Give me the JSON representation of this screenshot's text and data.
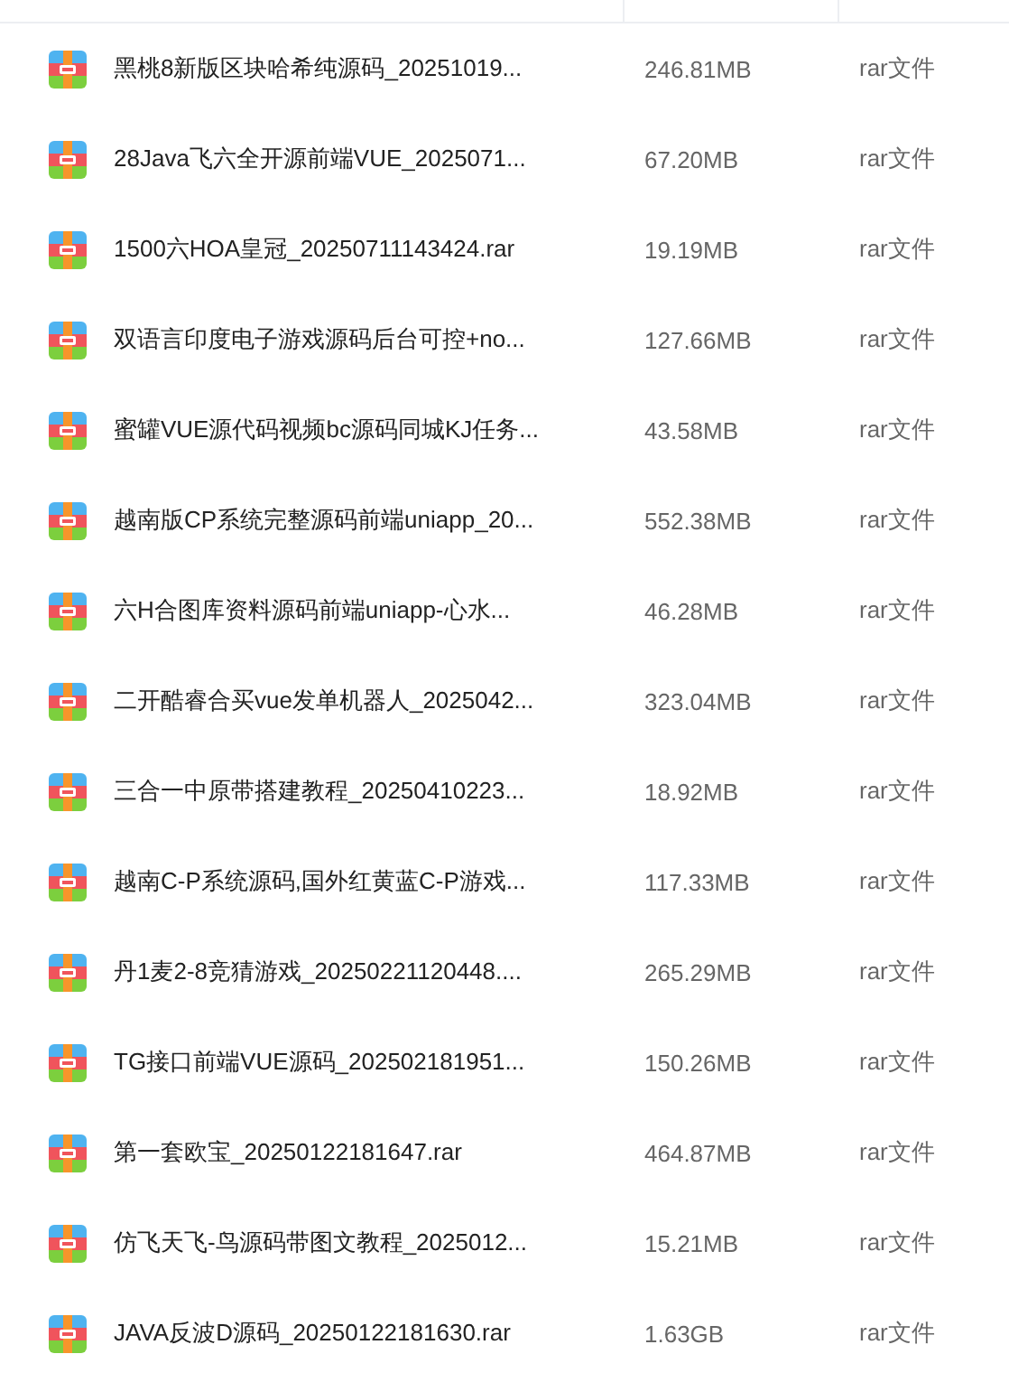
{
  "files": [
    {
      "name": "黑桃8新版区块哈希纯源码_20251019...",
      "size": "246.81MB",
      "type": "rar文件"
    },
    {
      "name": "28Java飞六全开源前端VUE_2025071...",
      "size": "67.20MB",
      "type": "rar文件"
    },
    {
      "name": "1500六HOA皇冠_20250711143424.rar",
      "size": "19.19MB",
      "type": "rar文件"
    },
    {
      "name": "双语言印度电子游戏源码后台可控+no...",
      "size": "127.66MB",
      "type": "rar文件"
    },
    {
      "name": "蜜罐VUE源代码视频bc源码同城KJ任务...",
      "size": "43.58MB",
      "type": "rar文件"
    },
    {
      "name": "越南版CP系统完整源码前端uniapp_20...",
      "size": "552.38MB",
      "type": "rar文件"
    },
    {
      "name": "六H合图库资料源码前端uniapp-心水...",
      "size": "46.28MB",
      "type": "rar文件"
    },
    {
      "name": "二开酷睿合买vue发单机器人_2025042...",
      "size": "323.04MB",
      "type": "rar文件"
    },
    {
      "name": "三合一中原带搭建教程_20250410223...",
      "size": "18.92MB",
      "type": "rar文件"
    },
    {
      "name": "越南C-P系统源码,国外红黄蓝C-P游戏...",
      "size": "117.33MB",
      "type": "rar文件"
    },
    {
      "name": "丹1麦2-8竞猜游戏_20250221120448....",
      "size": "265.29MB",
      "type": "rar文件"
    },
    {
      "name": "TG接口前端VUE源码_202502181951...",
      "size": "150.26MB",
      "type": "rar文件"
    },
    {
      "name": "第一套欧宝_20250122181647.rar",
      "size": "464.87MB",
      "type": "rar文件"
    },
    {
      "name": "仿飞天飞-鸟源码带图文教程_2025012...",
      "size": "15.21MB",
      "type": "rar文件"
    },
    {
      "name": "JAVA反波D源码_20250122181630.rar",
      "size": "1.63GB",
      "type": "rar文件"
    }
  ]
}
